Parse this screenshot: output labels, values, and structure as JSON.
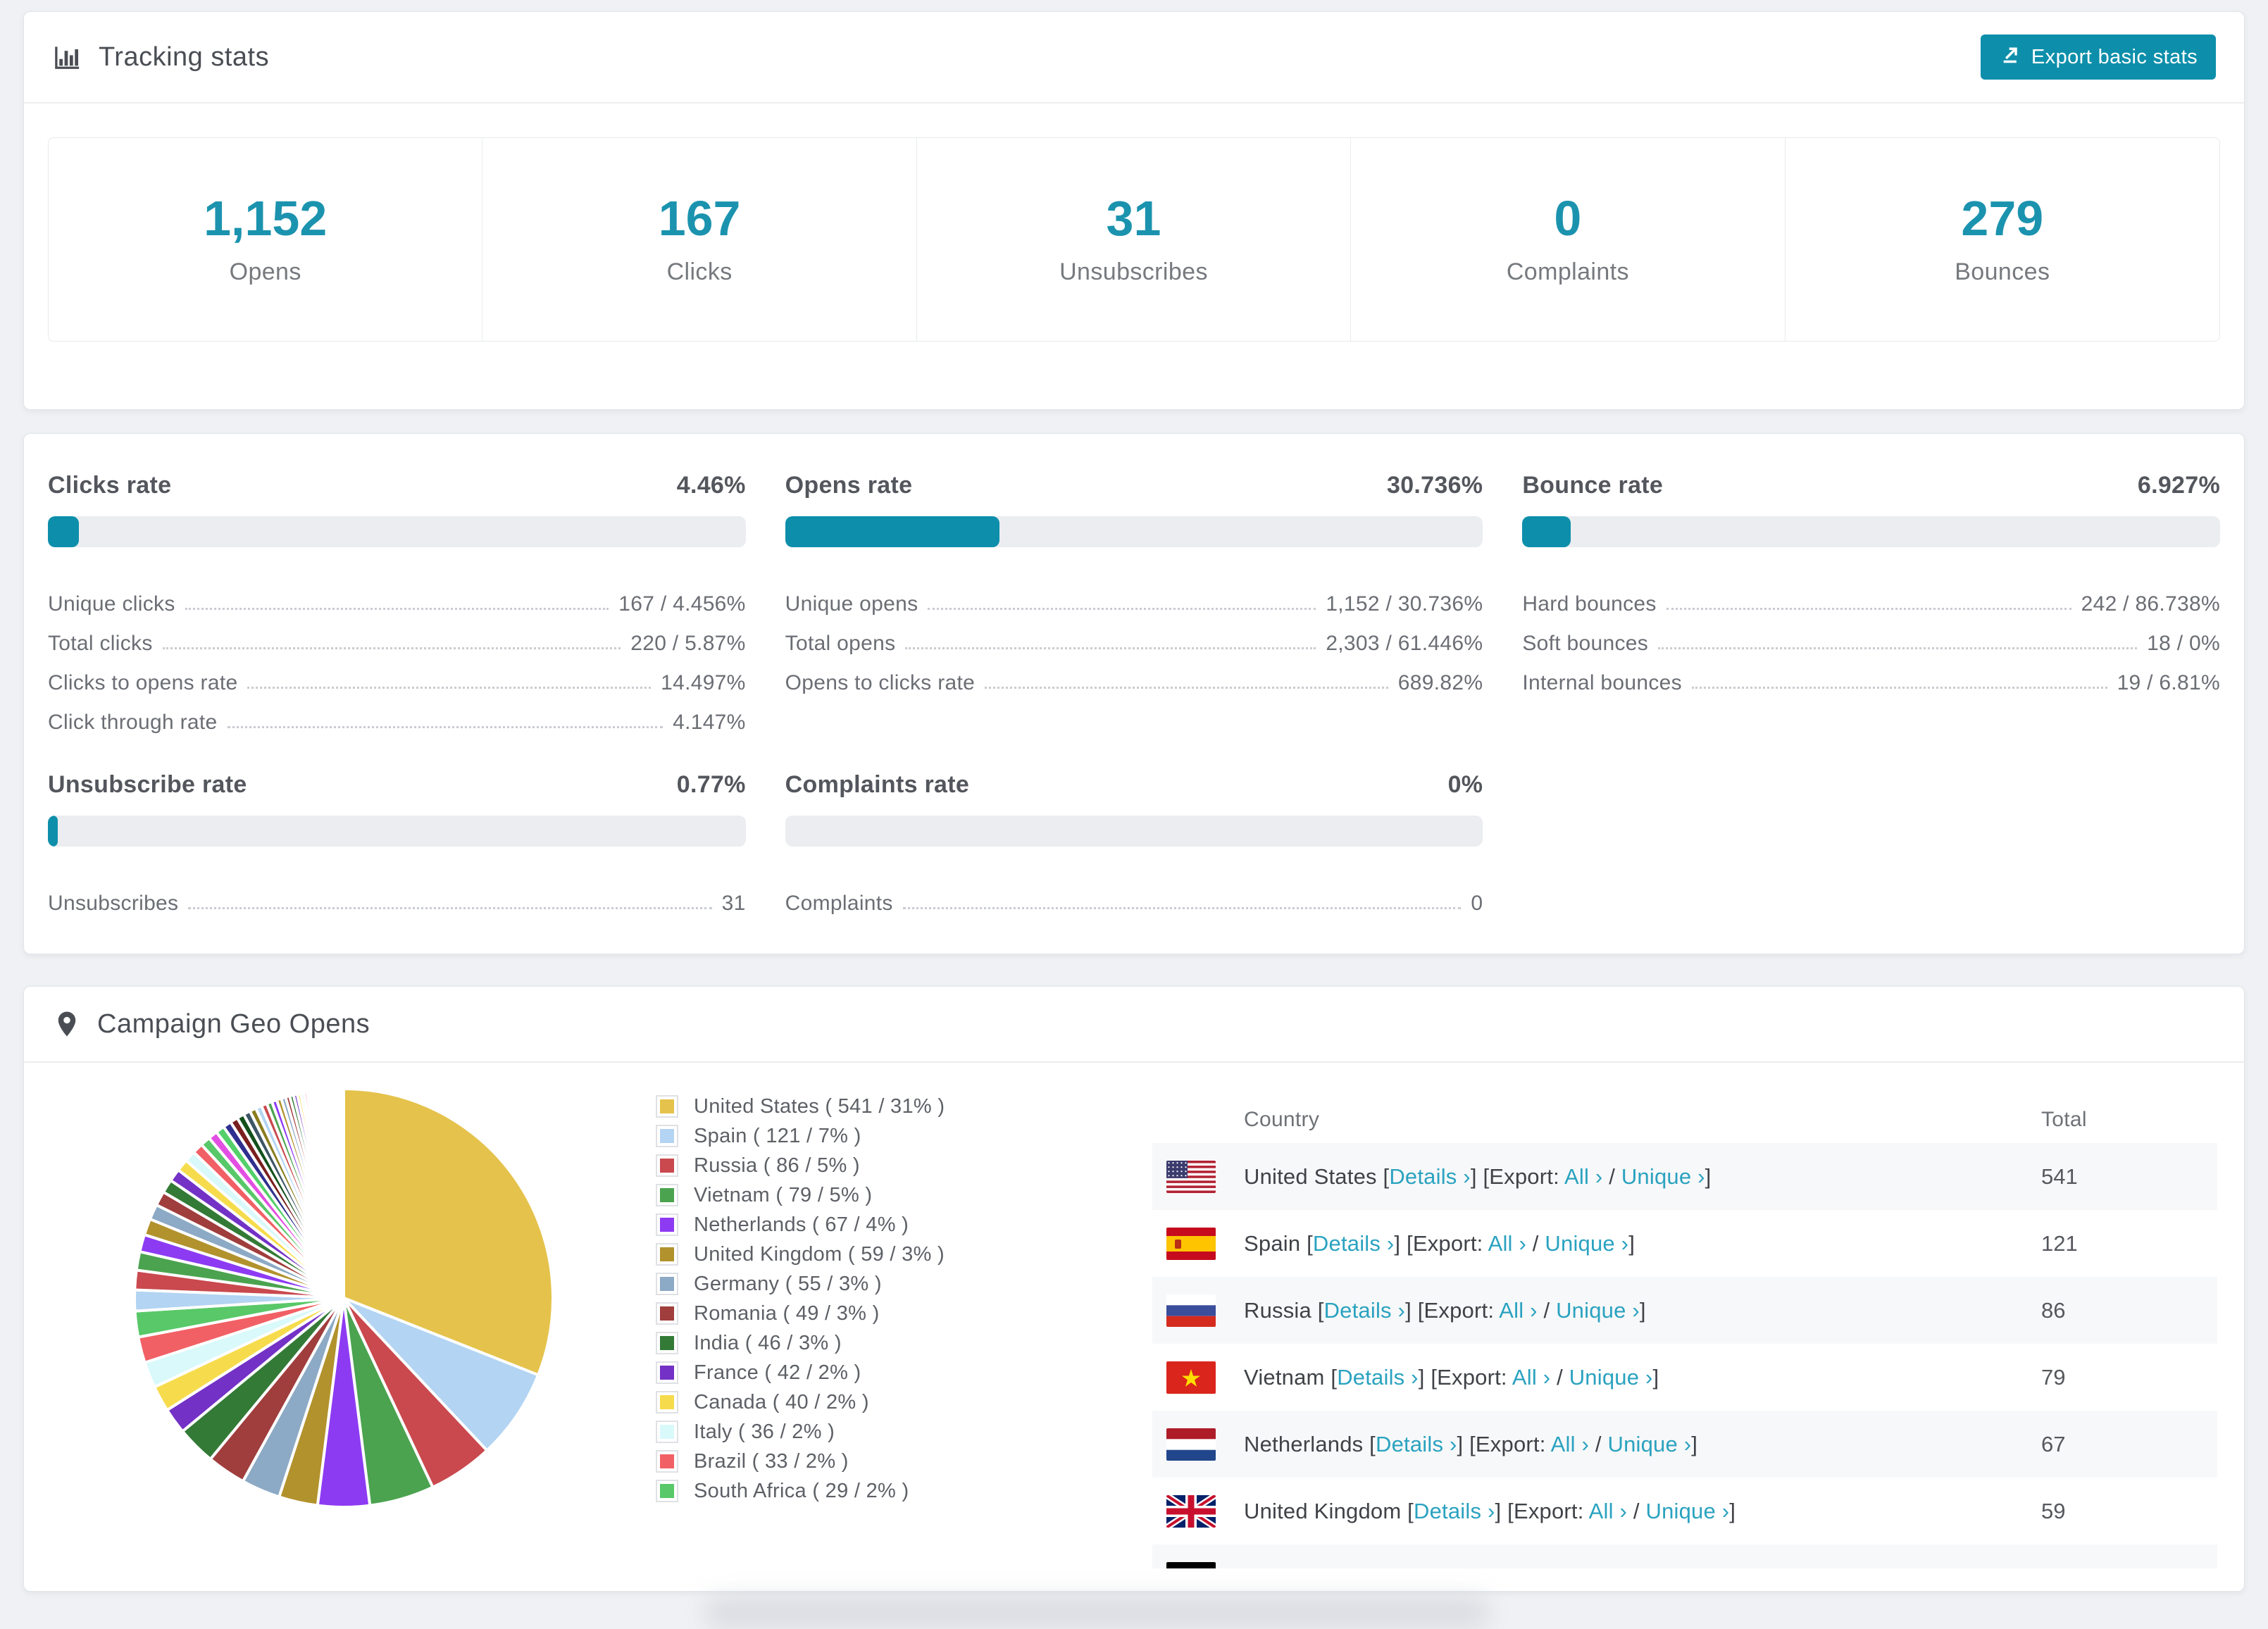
{
  "colors": {
    "accent": "#0d8fab",
    "number": "#1b93ae",
    "link": "#2aa2c0",
    "bar_bg": "#ebedf0"
  },
  "header": {
    "title": "Tracking stats",
    "export_label": "Export basic stats"
  },
  "summary_stats": [
    {
      "value": "1,152",
      "label": "Opens"
    },
    {
      "value": "167",
      "label": "Clicks"
    },
    {
      "value": "31",
      "label": "Unsubscribes"
    },
    {
      "value": "0",
      "label": "Complaints"
    },
    {
      "value": "279",
      "label": "Bounces"
    }
  ],
  "rates": [
    {
      "title": "Clicks rate",
      "value": "4.46%",
      "percent": 4.46,
      "rows": [
        {
          "label": "Unique clicks",
          "value": "167 / 4.456%"
        },
        {
          "label": "Total clicks",
          "value": "220 / 5.87%"
        },
        {
          "label": "Clicks to opens rate",
          "value": "14.497%"
        },
        {
          "label": "Click through rate",
          "value": "4.147%"
        }
      ]
    },
    {
      "title": "Opens rate",
      "value": "30.736%",
      "percent": 30.736,
      "rows": [
        {
          "label": "Unique opens",
          "value": "1,152 / 30.736%"
        },
        {
          "label": "Total opens",
          "value": "2,303 / 61.446%"
        },
        {
          "label": "Opens to clicks rate",
          "value": "689.82%"
        }
      ]
    },
    {
      "title": "Bounce rate",
      "value": "6.927%",
      "percent": 6.927,
      "rows": [
        {
          "label": "Hard bounces",
          "value": "242 / 86.738%"
        },
        {
          "label": "Soft bounces",
          "value": "18 / 0%"
        },
        {
          "label": "Internal bounces",
          "value": "19 / 6.81%"
        }
      ]
    },
    {
      "title": "Unsubscribe rate",
      "value": "0.77%",
      "percent": 0.77,
      "rows": [
        {
          "label": "Unsubscribes",
          "value": "31"
        }
      ]
    },
    {
      "title": "Complaints rate",
      "value": "0%",
      "percent": 0,
      "rows": [
        {
          "label": "Complaints",
          "value": "0"
        }
      ]
    }
  ],
  "geo": {
    "title": "Campaign Geo Opens",
    "table_headers": {
      "country": "Country",
      "total": "Total"
    },
    "link_labels": {
      "details": "Details ›",
      "export_prefix": "Export:",
      "all": "All ›",
      "unique": "Unique ›"
    },
    "punct": {
      "lb": "[",
      "rb": "]",
      "slash": "/"
    },
    "countries": [
      {
        "name": "United States",
        "total": "541",
        "percent": 31,
        "color": "#e5c24b",
        "flag": "us",
        "legend_label": "United States ( 541 / 31% )"
      },
      {
        "name": "Spain",
        "total": "121",
        "percent": 7,
        "color": "#b3d4f2",
        "flag": "es",
        "legend_label": "Spain ( 121 / 7% )"
      },
      {
        "name": "Russia",
        "total": "86",
        "percent": 5,
        "color": "#c9494e",
        "flag": "ru",
        "legend_label": "Russia ( 86 / 5% )"
      },
      {
        "name": "Vietnam",
        "total": "79",
        "percent": 5,
        "color": "#4ba34f",
        "flag": "vn",
        "legend_label": "Vietnam ( 79 / 5% )"
      },
      {
        "name": "Netherlands",
        "total": "67",
        "percent": 4,
        "color": "#8d3bf2",
        "flag": "nl",
        "legend_label": "Netherlands ( 67 / 4% )"
      },
      {
        "name": "United Kingdom",
        "total": "59",
        "percent": 3,
        "color": "#b2922d",
        "flag": "gb",
        "legend_label": "United Kingdom ( 59 / 3% )"
      },
      {
        "name": "Germany",
        "total": "55",
        "percent": 3,
        "color": "#8ca9c5",
        "flag": "de",
        "legend_label": "Germany ( 55 / 3% )"
      },
      {
        "name": "Romania",
        "total": "49",
        "percent": 3,
        "color": "#a03d3d",
        "flag": "ro",
        "legend_label": "Romania ( 49 / 3% )"
      },
      {
        "name": "India",
        "total": "46",
        "percent": 3,
        "color": "#337a36",
        "flag": "in",
        "legend_label": "India ( 46 / 3% )"
      },
      {
        "name": "France",
        "total": "42",
        "percent": 2,
        "color": "#7331c6",
        "flag": "fr",
        "legend_label": "France ( 42 / 2% )"
      },
      {
        "name": "Canada",
        "total": "40",
        "percent": 2,
        "color": "#f6dc4d",
        "flag": "ca",
        "legend_label": "Canada ( 40 / 2% )"
      },
      {
        "name": "Italy",
        "total": "36",
        "percent": 2,
        "color": "#d9f9fb",
        "flag": "it",
        "legend_label": "Italy ( 36 / 2% )"
      },
      {
        "name": "Brazil",
        "total": "33",
        "percent": 2,
        "color": "#f16065",
        "flag": "br",
        "legend_label": "Brazil ( 33 / 2% )"
      },
      {
        "name": "South Africa",
        "total": "29",
        "percent": 2,
        "color": "#58c868",
        "flag": "za",
        "legend_label": "South Africa ( 29 / 2% )"
      }
    ],
    "table_visible_rows": [
      "us",
      "es",
      "ru",
      "vn",
      "nl",
      "gb"
    ],
    "partial_next_row_flag": "de"
  },
  "chart_data": {
    "type": "pie",
    "title": "Campaign Geo Opens",
    "labels": [
      "United States",
      "Spain",
      "Russia",
      "Vietnam",
      "Netherlands",
      "United Kingdom",
      "Germany",
      "Romania",
      "India",
      "France",
      "Canada",
      "Italy",
      "Brazil",
      "South Africa"
    ],
    "values": [
      31,
      7,
      5,
      5,
      4,
      3,
      3,
      3,
      3,
      2,
      2,
      2,
      2,
      2
    ],
    "counts": [
      541,
      121,
      86,
      79,
      67,
      59,
      55,
      49,
      46,
      42,
      40,
      36,
      33,
      29
    ],
    "others_total_percent": 26,
    "others_slice_count": 55,
    "others_decay": 0.94,
    "others_palette": [
      "#b3d4f2",
      "#c9494e",
      "#4ba34f",
      "#8d3bf2",
      "#b2922d",
      "#8ca9c5",
      "#a03d3d",
      "#337a36",
      "#7331c6",
      "#f6dc4d",
      "#d9f9fb",
      "#f16065",
      "#58c868",
      "#e24fe2",
      "#54d06a",
      "#2f2f8f",
      "#7a1f1f",
      "#14501c",
      "#3c5566",
      "#8a7c1e"
    ],
    "start_angle": "top",
    "direction": "clockwise",
    "legend_position": "right"
  }
}
